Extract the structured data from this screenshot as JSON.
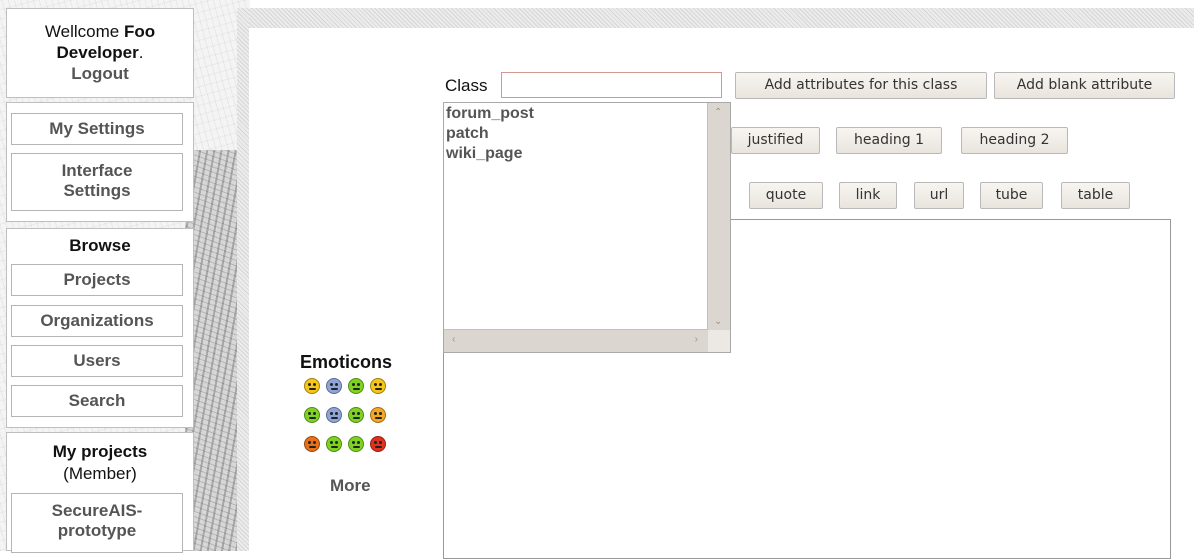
{
  "sidebar": {
    "welcome_prefix": "Wellcome ",
    "user_name": "Foo Developer",
    "user_suffix": ".",
    "logout_label": "Logout",
    "my_settings_label": "My Settings",
    "interface_settings_label": "Interface Settings",
    "browse_heading": "Browse",
    "projects_label": "Projects",
    "organizations_label": "Organizations",
    "users_label": "Users",
    "search_label": "Search",
    "my_projects_heading": "My projects",
    "member_label": "(Member)",
    "project_item_label": "SecureAIS-prototype"
  },
  "form": {
    "class_label": "Class",
    "class_value": "",
    "add_attributes_label": "Add attributes for this class",
    "add_blank_label": "Add blank attribute",
    "autocomplete_options": [
      "forum_post",
      "patch",
      "wiki_page"
    ]
  },
  "toolbar": {
    "row1": [
      "justified",
      "heading 1",
      "heading 2"
    ],
    "row2": [
      "quote",
      "link",
      "url",
      "tube",
      "table"
    ]
  },
  "emoticons": {
    "title": "Emoticons",
    "more_label": "More",
    "icons": [
      {
        "name": "smile-emoticon-icon",
        "color": "#f5c518"
      },
      {
        "name": "sad-emoticon-icon",
        "color": "#8fa4d8"
      },
      {
        "name": "neutral-emoticon-icon",
        "color": "#7ed321"
      },
      {
        "name": "grin-emoticon-icon",
        "color": "#f5c518"
      },
      {
        "name": "happy-emoticon-icon",
        "color": "#7ed321"
      },
      {
        "name": "surprised-emoticon-icon",
        "color": "#8fa4d8"
      },
      {
        "name": "confused-emoticon-icon",
        "color": "#7ed321"
      },
      {
        "name": "cool-emoticon-icon",
        "color": "#f5a623"
      },
      {
        "name": "angry-emoticon-icon",
        "color": "#e8701a"
      },
      {
        "name": "crying-emoticon-icon",
        "color": "#7ed321"
      },
      {
        "name": "dizzy-emoticon-icon",
        "color": "#7ed321"
      },
      {
        "name": "mad-emoticon-icon",
        "color": "#e0301e"
      }
    ]
  }
}
